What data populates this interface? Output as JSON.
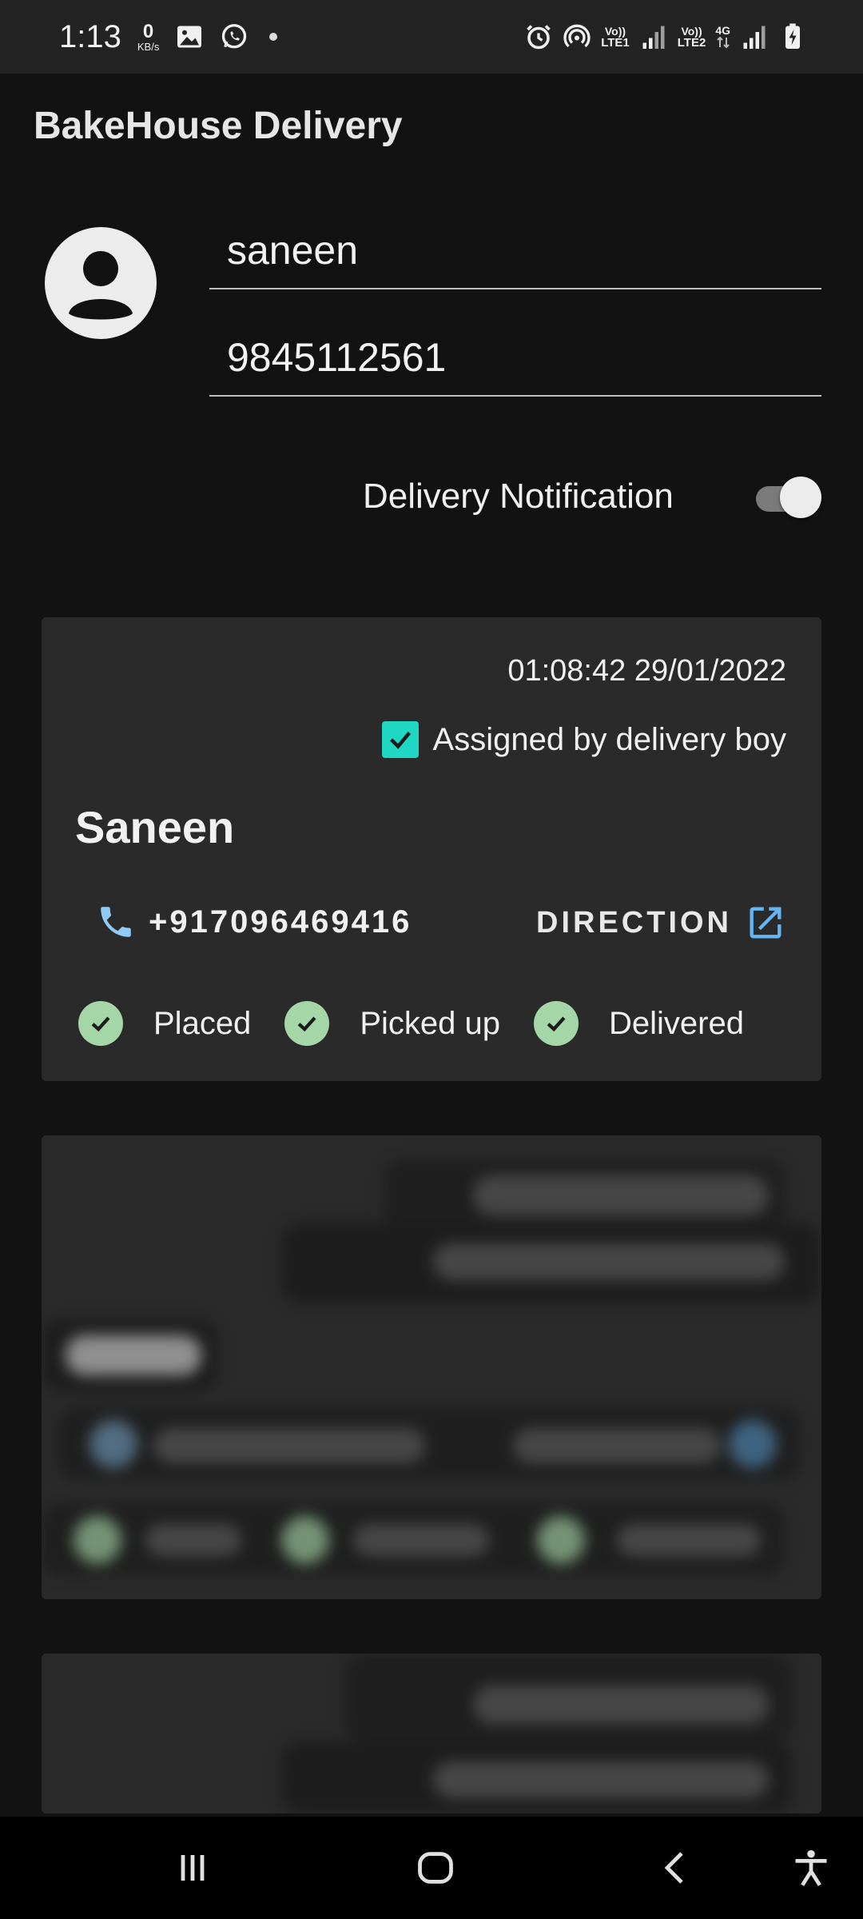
{
  "status_bar": {
    "time": "1:13",
    "net_speed_value": "0",
    "net_speed_unit": "KB/s",
    "sim1_top": "Vo))",
    "sim1_bottom": "LTE1",
    "sim2_top": "Vo))",
    "sim2_bottom": "LTE2",
    "network_type": "4G",
    "icons": [
      "gallery-icon",
      "whatsapp-icon",
      "alarm-icon",
      "hotspot-icon",
      "signal-icon",
      "battery-charging-icon"
    ]
  },
  "app_bar": {
    "title": "BakeHouse Delivery"
  },
  "profile": {
    "name_value": "saneen",
    "phone_value": "9845112561"
  },
  "settings": {
    "notification_label": "Delivery Notification",
    "notification_enabled": true
  },
  "orders": [
    {
      "timestamp": "01:08:42 29/01/2022",
      "assigned_label": "Assigned by delivery boy",
      "assigned_checked": true,
      "customer_name": "Saneen",
      "phone": "+917096469416",
      "direction_label": "DIRECTION",
      "steps": [
        {
          "label": "Placed",
          "done": true
        },
        {
          "label": "Picked up",
          "done": true
        },
        {
          "label": "Delivered",
          "done": true
        }
      ]
    }
  ],
  "colors": {
    "background": "#121212",
    "card": "#2a2a2a",
    "accent_checkbox": "#1ed8c4",
    "step_done": "#a5d6a7",
    "phone_icon": "#90caf9",
    "direction_icon": "#64b5f6"
  },
  "nav_bar": {
    "buttons": [
      "recents-icon",
      "home-icon",
      "back-icon",
      "accessibility-icon"
    ]
  }
}
